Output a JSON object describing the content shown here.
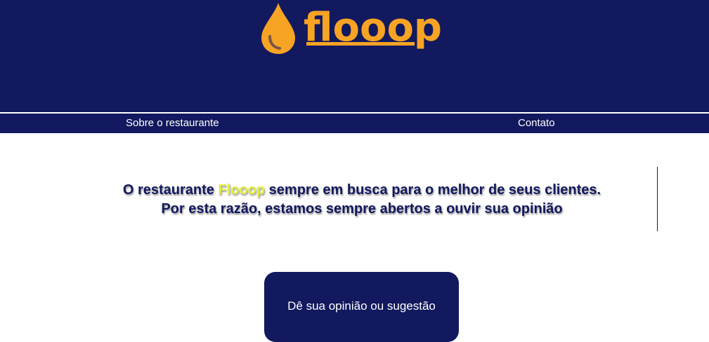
{
  "header": {
    "logo_text": "flooop",
    "logo_icon": "drop-icon",
    "background": "#12195e",
    "logo_color": "#f7a324"
  },
  "nav": {
    "items": [
      {
        "label": "Sobre o restaurante"
      },
      {
        "label": "Contato"
      }
    ]
  },
  "intro": {
    "line1_prefix": "O restaurante ",
    "brand": "Flooop",
    "line1_suffix": " sempre em busca para o melhor de seus clientes.",
    "line2": "Por esta razão, estamos sempre abertos a ouvir sua opinião",
    "text_color": "#12195e",
    "brand_color": "#e3ef3f"
  },
  "feedback_card": {
    "title": "Dê sua opinião ou sugestão"
  }
}
